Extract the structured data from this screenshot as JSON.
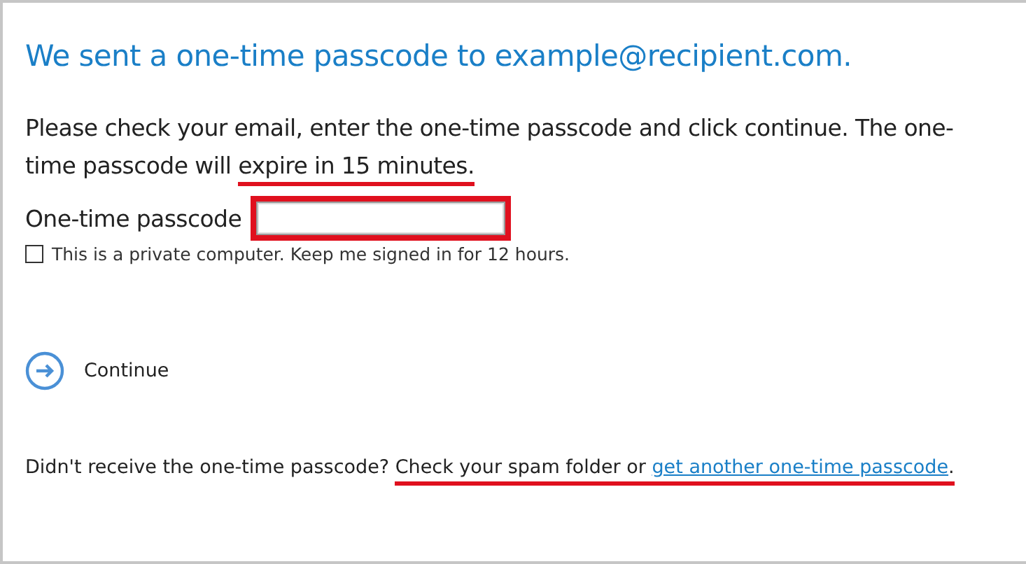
{
  "heading": "We sent a one-time passcode to example@recipient.com.",
  "instructions": [
    {
      "text": "Please check your email, enter the one-time passcode and click continue. The one-time passcode will ",
      "highlighted": false
    },
    {
      "text": "expire in 15 minutes.",
      "highlighted": true
    }
  ],
  "passcode_field": {
    "label": "One-time passcode",
    "highlighted": true
  },
  "keep_signed_in": {
    "label": "This is a private computer. Keep me signed in for 12 hours.",
    "checked": false
  },
  "continue_button": {
    "label": "Continue"
  },
  "footer": {
    "text": "Didn't receive the one-time passcode? ",
    "highlighted_text": "Check your spam folder or ",
    "link": "get another one-time passcode",
    "end": ".",
    "highlighted": true
  }
}
